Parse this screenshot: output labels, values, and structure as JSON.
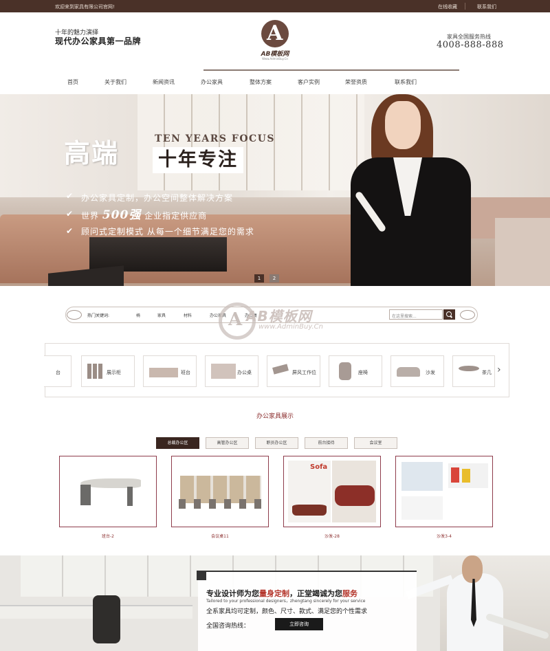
{
  "topbar": {
    "welcome": "欢迎来到家具有限公司官网!",
    "favorite": "在线收藏",
    "contact": "联系我们"
  },
  "header": {
    "slogan_small": "十年的魅力演绎",
    "slogan_big": "现代办公家具第一品牌",
    "logo_text": "AB模板网",
    "logo_sub": "Www.AdminBuy.Cn",
    "hotline_label": "家具全国服务热线",
    "hotline": "4008-888-888"
  },
  "nav": [
    {
      "label": "首页"
    },
    {
      "label": "关于我们"
    },
    {
      "label": "新闻资讯"
    },
    {
      "label": "办公家具"
    },
    {
      "label": "整体方案"
    },
    {
      "label": "客户实例"
    },
    {
      "label": "荣誉资质"
    },
    {
      "label": "联系我们"
    }
  ],
  "banner": {
    "title": "高端",
    "english": "TEN YEARS FOCUS",
    "ten_years": "十年专注",
    "lines": [
      {
        "check": "✔",
        "text": "办公家具定制，办公空间整体解决方案"
      },
      {
        "check": "✔",
        "pre": "世界",
        "bold": "500强",
        "post": "企业指定供应商"
      },
      {
        "check": "✔",
        "text": "顾问式定制模式  从每一个细节满足您的需求"
      }
    ],
    "pages": [
      "1",
      "2"
    ]
  },
  "keywords": {
    "label": "热门关键词:",
    "items": [
      "椅",
      "家具",
      "材料",
      "办公家具",
      "办公桌"
    ],
    "search_placeholder": "在这里搜索..."
  },
  "watermark": {
    "text": "AB模板网",
    "url": "www.AdminBuy.Cn"
  },
  "categories": {
    "items": [
      {
        "label": "台"
      },
      {
        "label": "展示柜"
      },
      {
        "label": "班台"
      },
      {
        "label": "办公桌"
      },
      {
        "label": "屏风工作位"
      },
      {
        "label": "座椅"
      },
      {
        "label": "沙发"
      },
      {
        "label": "茶几"
      }
    ],
    "prev": "‹",
    "next": "›"
  },
  "showcase": {
    "title": "办公家具展示",
    "tabs": [
      {
        "label": "总裁办公区",
        "active": true
      },
      {
        "label": "高管办公区",
        "active": false
      },
      {
        "label": "职员办公区",
        "active": false
      },
      {
        "label": "前台接待",
        "active": false
      },
      {
        "label": "会议室",
        "active": false
      }
    ],
    "products": [
      {
        "name": "班台-2"
      },
      {
        "name": "会议桌11"
      },
      {
        "name": "沙发-28"
      },
      {
        "name": "沙发3-4"
      }
    ],
    "product3_badge": "Sofa"
  },
  "service": {
    "line1_pre": "专业设计师为您",
    "line1_red1": "量身定制",
    "line1_mid": "，正堂竭诚为您",
    "line1_red2": "服务",
    "line2": "Tailored to your professional designers，zhengtang sincerely for your service",
    "line3": "全系家具均可定制，颜色、尺寸、款式、满足您的个性需求",
    "line4": "全国咨询热线：",
    "button": "立即咨询"
  },
  "colors": {
    "brand_dark": "#4a3128",
    "accent_red": "#8b2e2e",
    "product_border": "#8e3b4b"
  }
}
